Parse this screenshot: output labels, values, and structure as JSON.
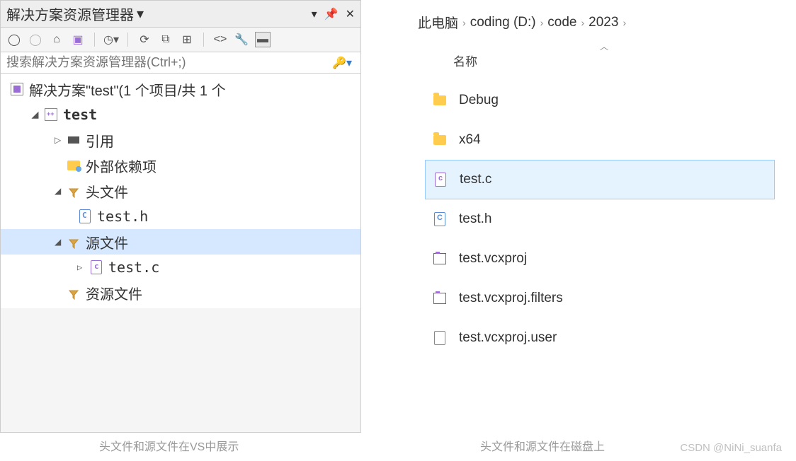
{
  "vs": {
    "title": "解决方案资源管理器",
    "dropdown_icon": "▾",
    "search_placeholder": "搜索解决方案资源管理器(Ctrl+;)",
    "solution_label": "解决方案\"test\"(1 个项目/共 1 个",
    "project": "test",
    "nodes": {
      "references": "引用",
      "external_deps": "外部依赖项",
      "header_files": "头文件",
      "test_h": "test.h",
      "source_files": "源文件",
      "test_c": "test.c",
      "resource_files": "资源文件"
    }
  },
  "explorer": {
    "breadcrumb": {
      "root": "此电脑",
      "drive": "coding (D:)",
      "folder1": "code",
      "folder2": "2023"
    },
    "column_name": "名称",
    "items": {
      "debug": "Debug",
      "x64": "x64",
      "test_c": "test.c",
      "test_h": "test.h",
      "vcxproj": "test.vcxproj",
      "vcxproj_filters": "test.vcxproj.filters",
      "vcxproj_user": "test.vcxproj.user"
    }
  },
  "captions": {
    "left": "头文件和源文件在VS中展示",
    "right": "头文件和源文件在磁盘上"
  },
  "watermark": "CSDN @NiNi_suanfa"
}
